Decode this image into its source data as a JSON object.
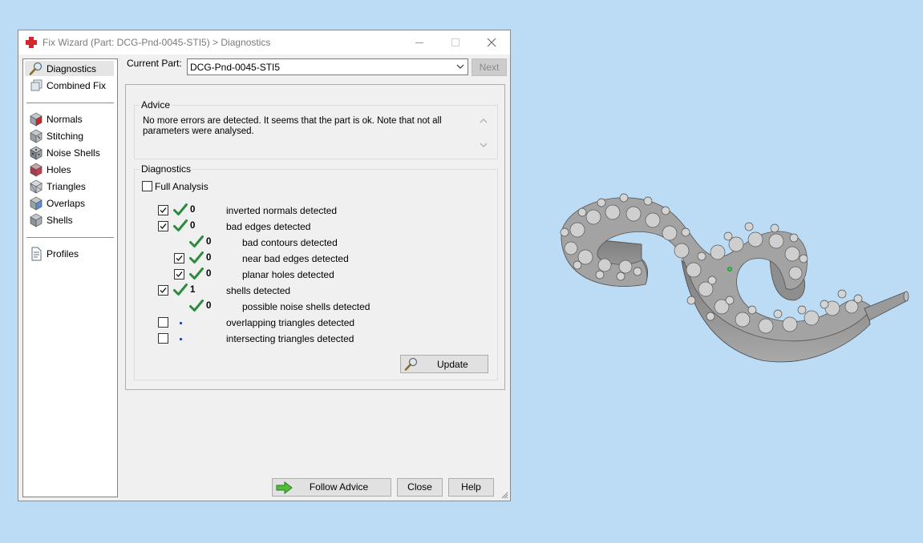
{
  "window": {
    "title": "Fix Wizard (Part: DCG-Pnd-0045-STI5) > Diagnostics",
    "app_icon": "red-cross-icon"
  },
  "nav": {
    "items": [
      {
        "label": "Diagnostics",
        "icon": "magnifier-icon",
        "selected": true
      },
      {
        "label": "Combined Fix",
        "icon": "stack-icon"
      },
      {
        "label": "Normals",
        "icon": "cube-red-icon"
      },
      {
        "label": "Stitching",
        "icon": "cube-stitch-icon"
      },
      {
        "label": "Noise Shells",
        "icon": "dice-icon"
      },
      {
        "label": "Holes",
        "icon": "cube-hole-icon"
      },
      {
        "label": "Triangles",
        "icon": "cube-wire-icon"
      },
      {
        "label": "Overlaps",
        "icon": "cube-overlap-icon"
      },
      {
        "label": "Shells",
        "icon": "cube-shell-icon"
      },
      {
        "label": "Profiles",
        "icon": "document-icon"
      }
    ]
  },
  "current_part": {
    "label": "Current Part:",
    "value": "DCG-Pnd-0045-STI5",
    "next_label": "Next"
  },
  "advice": {
    "title": "Advice",
    "text": "No more errors are detected. It seems that the part is ok. Note that not all parameters were analysed."
  },
  "diagnostics": {
    "title": "Diagnostics",
    "full_analysis_label": "Full Analysis",
    "full_analysis_checked": false,
    "rows": [
      {
        "checkbox": true,
        "checked": true,
        "status": "ok",
        "count": "0",
        "label": "inverted normals detected",
        "indent": 0
      },
      {
        "checkbox": true,
        "checked": true,
        "status": "ok",
        "count": "0",
        "label": "bad edges detected",
        "indent": 0
      },
      {
        "checkbox": false,
        "checked": false,
        "status": "ok",
        "count": "0",
        "label": "bad contours detected",
        "indent": 1
      },
      {
        "checkbox": true,
        "checked": true,
        "status": "ok",
        "count": "0",
        "label": "near bad edges detected",
        "indent": 1
      },
      {
        "checkbox": true,
        "checked": true,
        "status": "ok",
        "count": "0",
        "label": "planar holes detected",
        "indent": 1
      },
      {
        "checkbox": true,
        "checked": true,
        "status": "ok",
        "count": "1",
        "label": "shells detected",
        "indent": 0
      },
      {
        "checkbox": false,
        "checked": false,
        "status": "ok",
        "count": "0",
        "label": "possible noise shells detected",
        "indent": 1
      },
      {
        "checkbox": true,
        "checked": false,
        "status": "none",
        "count": "",
        "label": "overlapping triangles detected",
        "indent": 0
      },
      {
        "checkbox": true,
        "checked": false,
        "status": "none",
        "count": "",
        "label": "intersecting triangles detected",
        "indent": 0
      }
    ],
    "update_label": "Update"
  },
  "buttons": {
    "follow_advice": "Follow Advice",
    "close": "Close",
    "help": "Help"
  },
  "colors": {
    "background": "#bcdcf6",
    "check_green": "#2e8b3e",
    "model_gray": "#8c8c8c"
  }
}
